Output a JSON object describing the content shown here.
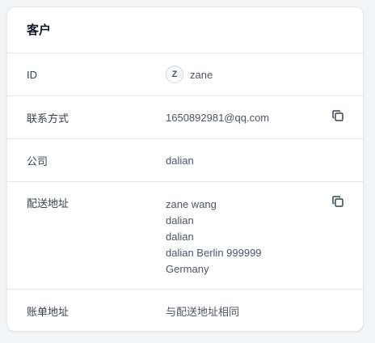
{
  "card": {
    "title": "客户"
  },
  "rows": {
    "id": {
      "label": "ID",
      "avatar": "Z",
      "value": "zane"
    },
    "contact": {
      "label": "联系方式",
      "value": "1650892981@qq.com",
      "copy_icon": "copy-icon"
    },
    "company": {
      "label": "公司",
      "value": "dalian"
    },
    "shipping": {
      "label": "配送地址",
      "lines": [
        "zane wang",
        "dalian",
        "dalian",
        "dalian Berlin 999999",
        "Germany"
      ],
      "copy_icon": "copy-icon"
    },
    "billing": {
      "label": "账单地址",
      "value": "与配送地址相同"
    }
  }
}
